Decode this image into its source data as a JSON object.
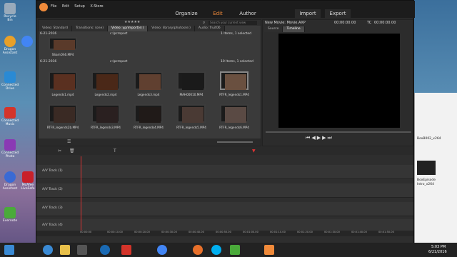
{
  "desktop": {
    "icons": [
      {
        "label": "Recycle Bin",
        "color": "#9ab"
      },
      {
        "label": "Dragon Assistant",
        "color": "#e8a02a"
      },
      {
        "label": "Google Chrome",
        "color": "#4285f4"
      },
      {
        "label": "Connected Drive",
        "color": "#2a8ad4"
      },
      {
        "label": "Connected Music",
        "color": "#d4342a"
      },
      {
        "label": "Connected Photo",
        "color": "#8a3ab4"
      },
      {
        "label": "Dragon Assistant",
        "color": "#3a6ad4"
      },
      {
        "label": "McAfee LiveSafe",
        "color": "#c8202a"
      },
      {
        "label": "Evernote",
        "color": "#4aaa3a"
      }
    ]
  },
  "app": {
    "menu": [
      "File",
      "Edit",
      "Setup",
      "X-Store"
    ],
    "modes": {
      "organize": "Organize",
      "edit": "Edit",
      "author": "Author"
    },
    "actions": {
      "import": "Import",
      "export": "Export"
    },
    "library": {
      "tabs": [
        "Video: Standard",
        "Transitions: (one)",
        "Video: yp/import(e:)",
        "Video: library/photos(e:)",
        "Audio: fruit06"
      ],
      "search_placeholder": "Search your current view",
      "group1": {
        "date": "6-21-2016",
        "path": "c:/pcmport",
        "info": "1 Items, 1 selected",
        "clip": "SSamOh6.MP4"
      },
      "group2": {
        "date": "6-21-2016",
        "path": "c:/pcmport",
        "info": "10 Items, 1 selected",
        "clips": [
          {
            "name": "Legends1.mp4",
            "color": "#5a3020"
          },
          {
            "name": "Legends2.mp4",
            "color": "#4a2818"
          },
          {
            "name": "Legends3.mp4",
            "color": "#604030"
          },
          {
            "name": "MAH00010.MP4",
            "color": "#1a1a1a"
          },
          {
            "name": "RTFR_legends1.MP4",
            "color": "#6a5040"
          },
          {
            "name": "RTFR_legends2b.MP4",
            "color": "#3a2a24"
          },
          {
            "name": "RTFR_legends3.MP4",
            "color": "#2a2020"
          },
          {
            "name": "RTFR_legends4.MP4",
            "color": "#201a18"
          },
          {
            "name": "RTFR_legends5.MP4",
            "color": "#4a3a34"
          },
          {
            "name": "RTFR_legends6.MP4",
            "color": "#5a4a44"
          }
        ]
      }
    },
    "player": {
      "title": "New Movie: Movie.AXP",
      "timecode": "00:00:00.00",
      "tc_label": "TC",
      "tc_timecode": "00:00:00.00",
      "tabs": [
        "Source",
        "Timeline"
      ]
    },
    "timeline": {
      "tracks": [
        "A/V Track (1)",
        "A/V Track (2)",
        "A/V Track (3)",
        "A/V Track (4)"
      ],
      "ruler": [
        "00:00:00",
        "00:00:10.00",
        "00:00:20.00",
        "00:00:30.00",
        "00:00:40.00",
        "00:00:50.00",
        "00:01:00.00",
        "00:01:10.00",
        "00:01:20.00",
        "00:01:30.00",
        "00:01:40.00",
        "00:01:50.00"
      ]
    }
  },
  "side_window": {
    "items": [
      "BoxB002_x264",
      "BoxEpisode",
      "Intro_x264"
    ]
  },
  "taskbar": {
    "time": "5:03 PM",
    "date": "6/21/2016"
  }
}
